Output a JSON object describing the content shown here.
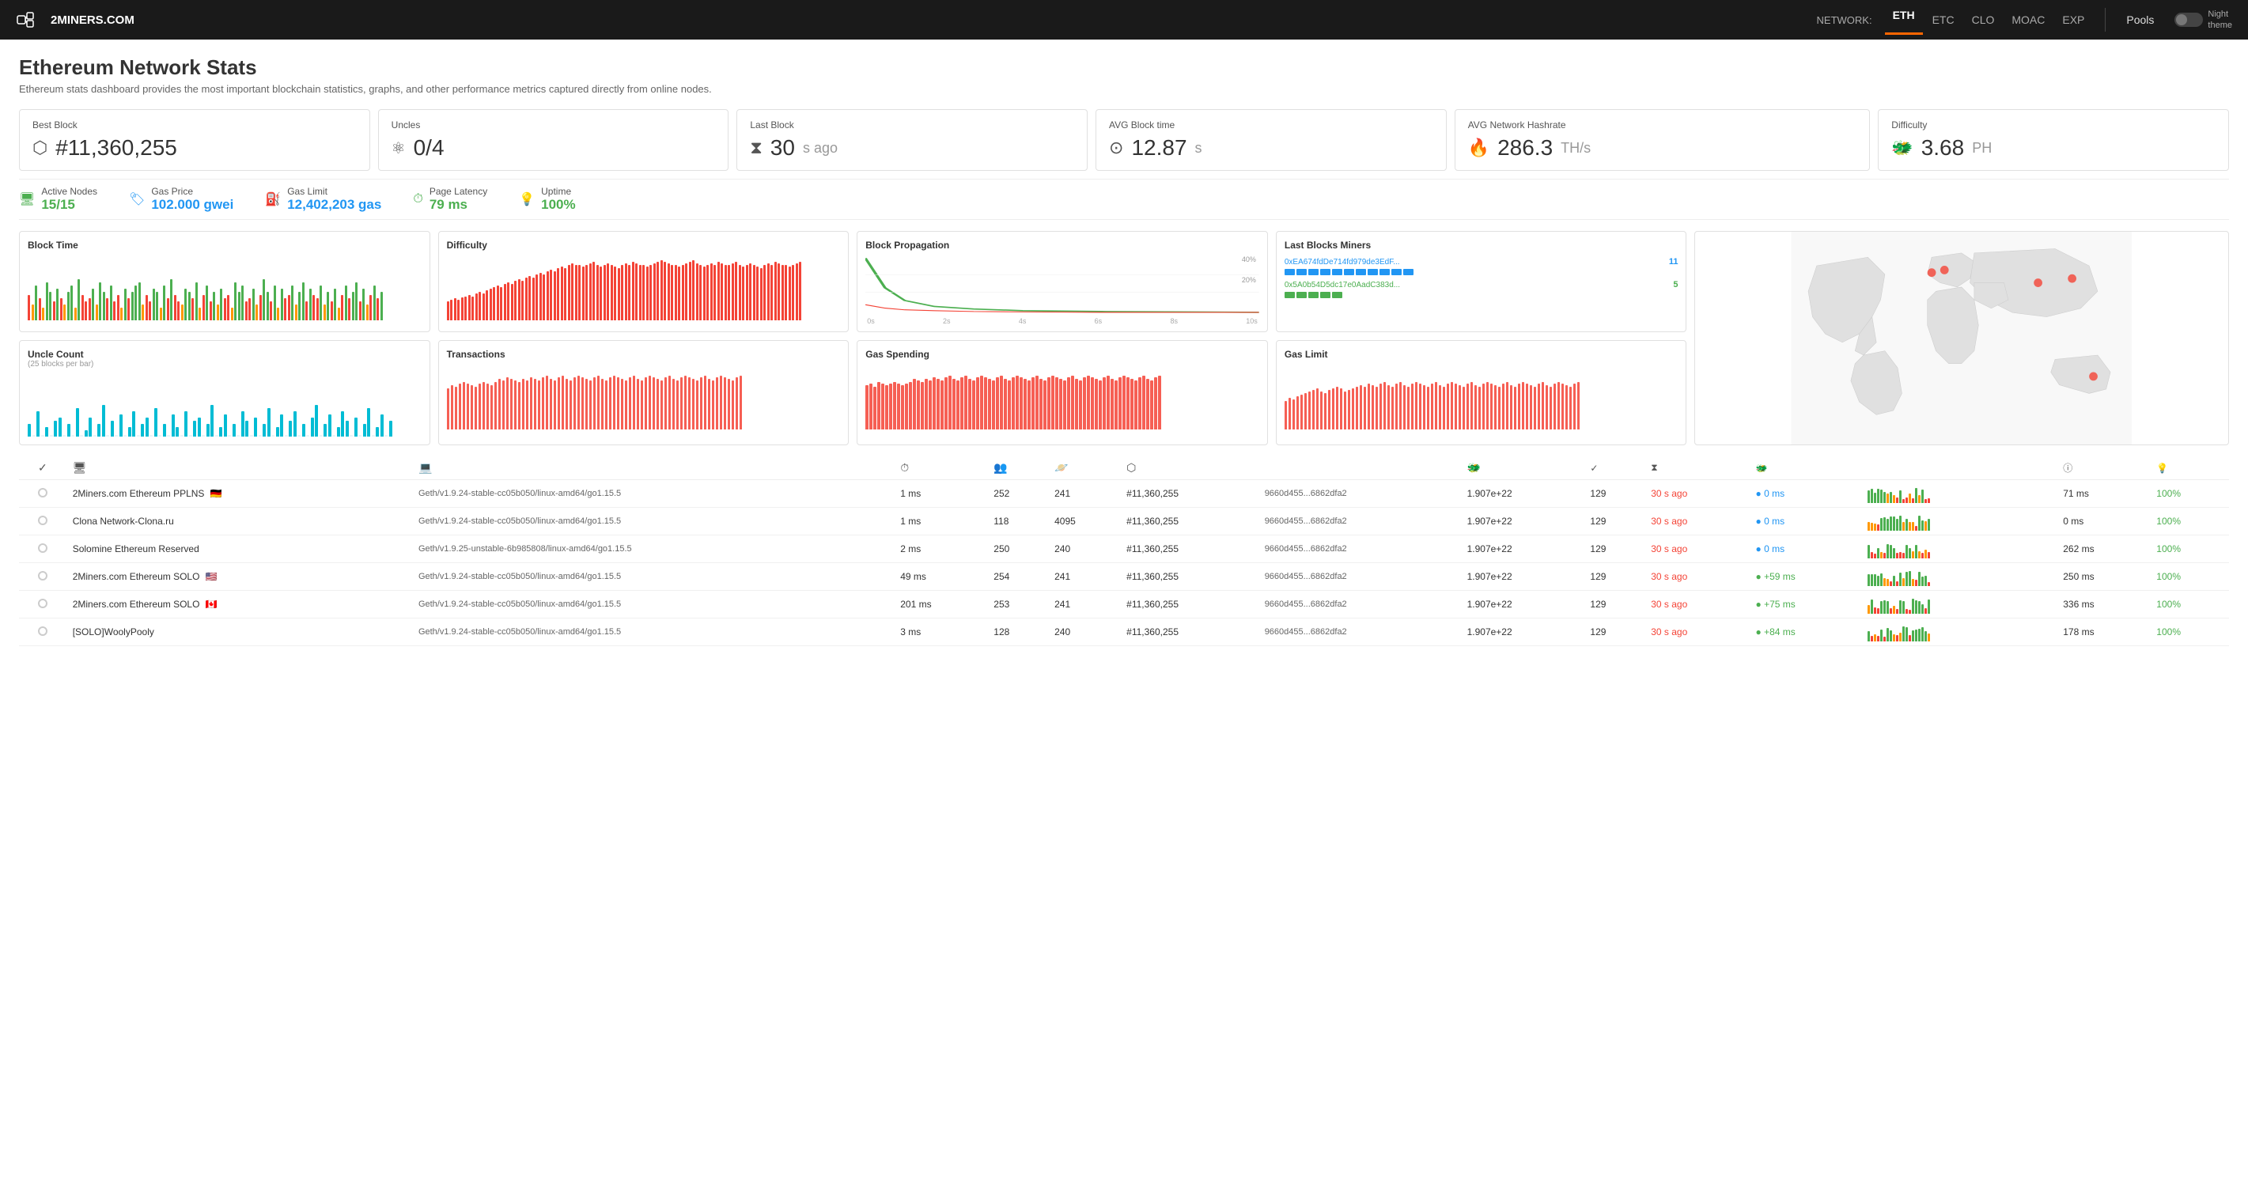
{
  "header": {
    "logo": "2MINERS.COM",
    "network_label": "NETWORK:",
    "nav_items": [
      "ETH",
      "ETC",
      "CLO",
      "MOAC",
      "EXP"
    ],
    "active_nav": "ETH",
    "pools_label": "Pools",
    "toggle_label": "Night\ntheme"
  },
  "page": {
    "title": "Ethereum Network Stats",
    "subtitle": "Ethereum stats dashboard provides the most important blockchain statistics, graphs, and other performance metrics captured directly from online nodes."
  },
  "stat_cards": [
    {
      "label": "Best Block",
      "value": "#11,360,255",
      "icon": "⬡"
    },
    {
      "label": "Uncles",
      "value": "0/4",
      "icon": "⚛"
    },
    {
      "label": "Last Block",
      "value": "30",
      "unit": "s ago",
      "icon": "⧗"
    },
    {
      "label": "AVG Block time",
      "value": "12.87",
      "unit": "s",
      "icon": "⊙"
    },
    {
      "label": "AVG Network Hashrate",
      "value": "286.3",
      "unit": "TH/s",
      "icon": "🔥"
    },
    {
      "label": "Difficulty",
      "value": "3.68",
      "unit": "PH",
      "icon": "🐲"
    }
  ],
  "stat_cards_2": [
    {
      "label": "Active Nodes",
      "value": "15/15",
      "color": "green",
      "icon": "🖥"
    },
    {
      "label": "Gas Price",
      "value": "102.000 gwei",
      "color": "blue",
      "icon": "🏷"
    },
    {
      "label": "Gas Limit",
      "value": "12,402,203 gas",
      "color": "blue",
      "icon": "⛽"
    },
    {
      "label": "Page Latency",
      "value": "79 ms",
      "color": "green",
      "icon": "⏱"
    },
    {
      "label": "Uptime",
      "value": "100%",
      "color": "green",
      "icon": "💡"
    }
  ],
  "charts": {
    "block_time": {
      "title": "Block Time"
    },
    "difficulty": {
      "title": "Difficulty"
    },
    "block_propagation": {
      "title": "Block Propagation"
    },
    "last_blocks_miners": {
      "title": "Last Blocks Miners",
      "miners": [
        {
          "addr": "0xEA674fdDe714fd979de3EdF...",
          "count": 11,
          "color": "#2196f3"
        },
        {
          "addr": "0x5A0b54D5dc17e0AadC383d...",
          "count": 5,
          "color": "#4caf50"
        }
      ]
    },
    "uncle_count": {
      "title": "Uncle Count",
      "subtitle": "(25 blocks per bar)"
    },
    "transactions": {
      "title": "Transactions"
    },
    "gas_spending": {
      "title": "Gas Spending"
    },
    "gas_limit": {
      "title": "Gas Limit"
    }
  },
  "table": {
    "headers": [
      "",
      "",
      "",
      "",
      "",
      "",
      "",
      "",
      "",
      "",
      "",
      "",
      "",
      "",
      "",
      ""
    ],
    "rows": [
      {
        "name": "2Miners.com Ethereum PPLNS",
        "flag": "🇩🇪",
        "client": "Geth/v1.9.24-stable-cc05b050/linux-amd64/go1.15.5",
        "latency": "1 ms",
        "peers": "252",
        "pending": "241",
        "block": "#11,360,255",
        "block_hash": "9660d455...6862dfa2",
        "difficulty": "1.907e+22",
        "tx": "129",
        "last_block": "30 s ago",
        "propagation": "● 0 ms",
        "prop_color": "blue",
        "uptime": "100%",
        "latency2": "71 ms"
      },
      {
        "name": "Clona Network-Clona.ru",
        "flag": "",
        "client": "Geth/v1.9.24-stable-cc05b050/linux-amd64/go1.15.5",
        "latency": "1 ms",
        "peers": "118",
        "pending": "4095",
        "block": "#11,360,255",
        "block_hash": "9660d455...6862dfa2",
        "difficulty": "1.907e+22",
        "tx": "129",
        "last_block": "30 s ago",
        "propagation": "● 0 ms",
        "prop_color": "blue",
        "uptime": "100%",
        "latency2": "0 ms"
      },
      {
        "name": "Solomine Ethereum Reserved",
        "flag": "",
        "client": "Geth/v1.9.25-unstable-6b985808/linux-amd64/go1.15.5",
        "latency": "2 ms",
        "peers": "250",
        "pending": "240",
        "block": "#11,360,255",
        "block_hash": "9660d455...6862dfa2",
        "difficulty": "1.907e+22",
        "tx": "129",
        "last_block": "30 s ago",
        "propagation": "● 0 ms",
        "prop_color": "blue",
        "uptime": "100%",
        "latency2": "262 ms"
      },
      {
        "name": "2Miners.com Ethereum SOLO",
        "flag": "🇺🇸",
        "client": "Geth/v1.9.24-stable-cc05b050/linux-amd64/go1.15.5",
        "latency": "49 ms",
        "peers": "254",
        "pending": "241",
        "block": "#11,360,255",
        "block_hash": "9660d455...6862dfa2",
        "difficulty": "1.907e+22",
        "tx": "129",
        "last_block": "30 s ago",
        "propagation": "+59 ms",
        "prop_color": "green",
        "uptime": "100%",
        "latency2": "250 ms"
      },
      {
        "name": "2Miners.com Ethereum SOLO",
        "flag": "🇨🇦",
        "client": "Geth/v1.9.24-stable-cc05b050/linux-amd64/go1.15.5",
        "latency": "201 ms",
        "peers": "253",
        "pending": "241",
        "block": "#11,360,255",
        "block_hash": "9660d455...6862dfa2",
        "difficulty": "1.907e+22",
        "tx": "129",
        "last_block": "30 s ago",
        "propagation": "+75 ms",
        "prop_color": "green",
        "uptime": "100%",
        "latency2": "336 ms"
      },
      {
        "name": "[SOLO]WoolyPooly",
        "flag": "",
        "client": "Geth/v1.9.24-stable-cc05b050/linux-amd64/go1.15.5",
        "latency": "3 ms",
        "peers": "128",
        "pending": "240",
        "block": "#11,360,255",
        "block_hash": "9660d455...6862dfa2",
        "difficulty": "1.907e+22",
        "tx": "129",
        "last_block": "30 s ago",
        "propagation": "+84 ms",
        "prop_color": "green",
        "uptime": "100%",
        "latency2": "178 ms"
      }
    ]
  }
}
